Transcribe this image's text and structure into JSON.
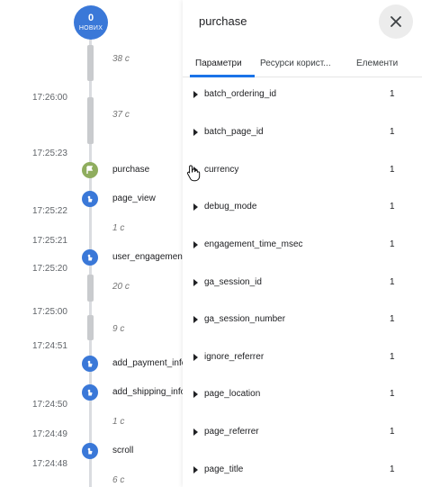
{
  "timeline": {
    "badge": {
      "count": "0",
      "label": "НОВИХ"
    },
    "timestamps": [
      "17:26:00",
      "17:25:23",
      "17:25:22",
      "17:25:21",
      "17:25:20",
      "17:25:00",
      "17:24:51",
      "17:24:50",
      "17:24:49",
      "17:24:48"
    ],
    "durations": [
      "38 с",
      "37 с",
      "1 с",
      "20 с",
      "9 с",
      "1 с",
      "6 с"
    ],
    "events": [
      {
        "name": "purchase",
        "icon": "flag-icon"
      },
      {
        "name": "page_view",
        "icon": "touch-icon"
      },
      {
        "name": "user_engagement",
        "icon": "touch-icon"
      },
      {
        "name": "add_payment_info",
        "icon": "touch-icon"
      },
      {
        "name": "add_shipping_info",
        "icon": "touch-icon"
      },
      {
        "name": "scroll",
        "icon": "touch-icon"
      }
    ]
  },
  "panel": {
    "title": "purchase",
    "tabs": [
      "Параметри",
      "Ресурси корист...",
      "Елементи"
    ],
    "active_tab": "Параметри",
    "params": [
      {
        "name": "batch_ordering_id",
        "count": "1"
      },
      {
        "name": "batch_page_id",
        "count": "1"
      },
      {
        "name": "currency",
        "count": "1"
      },
      {
        "name": "debug_mode",
        "count": "1"
      },
      {
        "name": "engagement_time_msec",
        "count": "1"
      },
      {
        "name": "ga_session_id",
        "count": "1"
      },
      {
        "name": "ga_session_number",
        "count": "1"
      },
      {
        "name": "ignore_referrer",
        "count": "1"
      },
      {
        "name": "page_location",
        "count": "1"
      },
      {
        "name": "page_referrer",
        "count": "1"
      },
      {
        "name": "page_title",
        "count": "1"
      }
    ]
  },
  "colors": {
    "accent": "#1a73e8",
    "event_dot": "#3a78d8",
    "flag_dot": "#8fad5e"
  }
}
